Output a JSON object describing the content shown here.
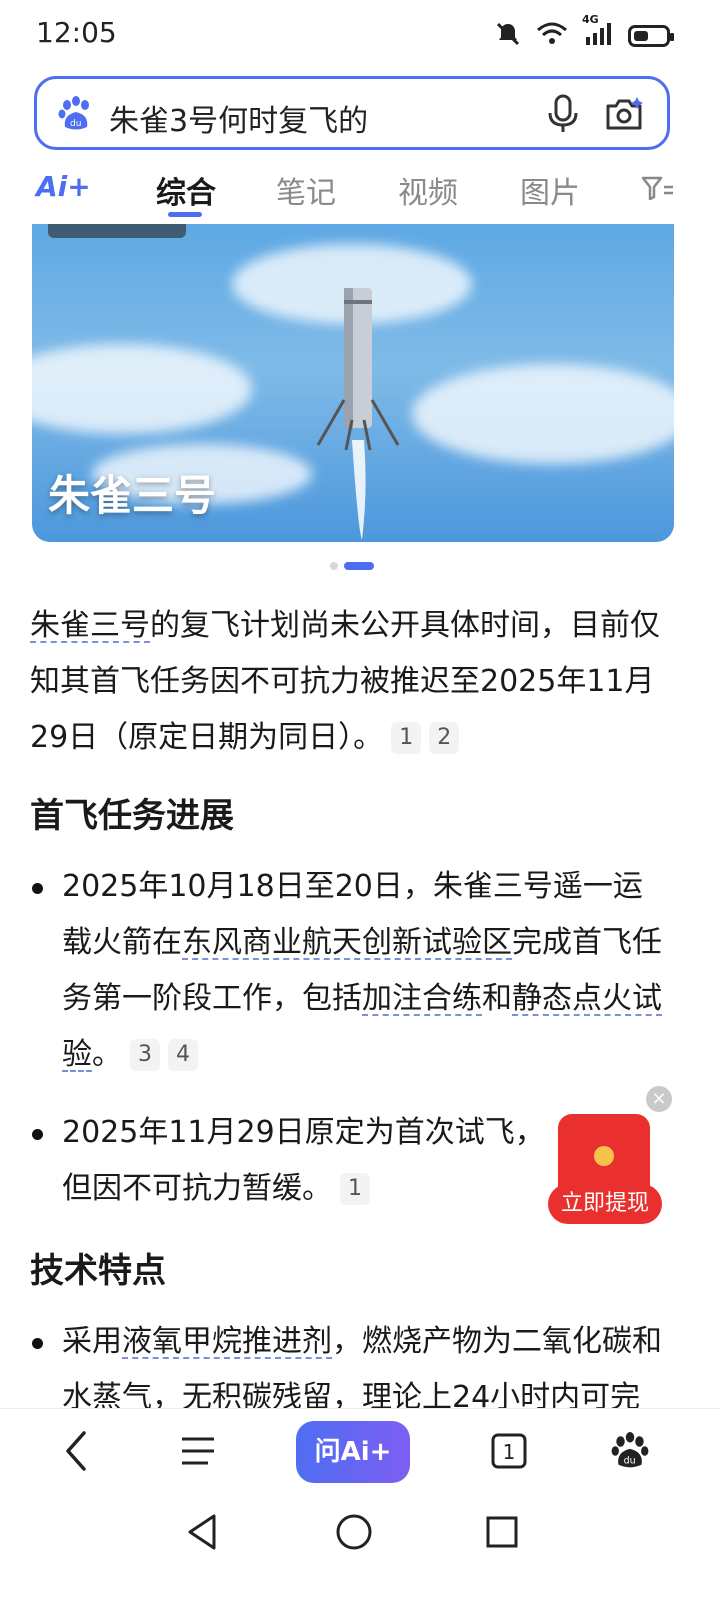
{
  "status_bar": {
    "time": "12:05",
    "network": "4G",
    "battery_level": 0.45
  },
  "search": {
    "query": "朱雀3号何时复飞的"
  },
  "tabs": {
    "ai_label": "Ai+",
    "items": [
      {
        "label": "综合",
        "active": true
      },
      {
        "label": "笔记",
        "active": false
      },
      {
        "label": "视频",
        "active": false
      },
      {
        "label": "图片",
        "active": false
      }
    ]
  },
  "hero": {
    "caption": "朱雀三号",
    "slide_index": 2,
    "slide_count": 2
  },
  "answer": {
    "intro": {
      "link": "朱雀三号",
      "text": "的复飞计划尚未公开具体时间，目前仅知其首飞任务因不可抗力被推迟至2025年11月29日（原定日期为同日）。",
      "citations": [
        "1",
        "2"
      ]
    },
    "section1": {
      "heading": "首飞任务进展",
      "bullet1": {
        "part1": "2025年10月18日至20日，朱雀三号遥一运载火箭在",
        "link1": "东风商业航天创新试验区",
        "part2": "完成首飞任务第一阶段工作，包括",
        "link2": "加注合练",
        "part3": "和",
        "link3": "静态点火试验",
        "part4": "。",
        "citations": [
          "3",
          "4"
        ]
      },
      "bullet2": {
        "text": "2025年11月29日原定为首次试飞，但因不可抗力暂缓",
        "end": "。",
        "citations": [
          "1"
        ]
      }
    },
    "section2": {
      "heading": "技术特点",
      "bullet1": {
        "part1": "采用",
        "link1": "液氧甲烷推进剂",
        "part2": "，燃烧产物为二氧化碳和水蒸气，无积碳残留，理论上24小时内可完"
      }
    }
  },
  "promo": {
    "button_label": "立即提现",
    "close_label": "×"
  },
  "bottom_bar": {
    "ask_ai_label": "问Ai+",
    "tab_count": "1"
  }
}
